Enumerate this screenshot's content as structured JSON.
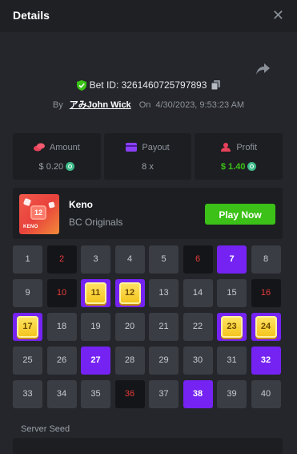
{
  "header": {
    "title": "Details",
    "close_icon": "close-icon"
  },
  "bet": {
    "id_label": "Bet ID: 3261460725797893",
    "by_label": "By",
    "username": "アみJohn Wick",
    "on_label": "On",
    "datetime": "4/30/2023, 9:53:23 AM"
  },
  "stats": {
    "amount": {
      "label": "Amount",
      "value": "$ 0.20",
      "icon": "coins-icon"
    },
    "payout": {
      "label": "Payout",
      "value": "8 x",
      "icon": "card-icon"
    },
    "profit": {
      "label": "Profit",
      "value": "$ 1.40",
      "icon": "user-icon"
    }
  },
  "game": {
    "name": "Keno",
    "category": "BC Originals",
    "play_label": "Play Now",
    "thumb_number": "12",
    "thumb_label": "KENO"
  },
  "board": {
    "cells": [
      {
        "n": "1",
        "s": "normal"
      },
      {
        "n": "2",
        "s": "miss"
      },
      {
        "n": "3",
        "s": "normal"
      },
      {
        "n": "4",
        "s": "normal"
      },
      {
        "n": "5",
        "s": "normal"
      },
      {
        "n": "6",
        "s": "miss"
      },
      {
        "n": "7",
        "s": "pick"
      },
      {
        "n": "8",
        "s": "normal"
      },
      {
        "n": "9",
        "s": "normal"
      },
      {
        "n": "10",
        "s": "miss"
      },
      {
        "n": "11",
        "s": "hit"
      },
      {
        "n": "12",
        "s": "hit"
      },
      {
        "n": "13",
        "s": "normal"
      },
      {
        "n": "14",
        "s": "normal"
      },
      {
        "n": "15",
        "s": "normal"
      },
      {
        "n": "16",
        "s": "miss"
      },
      {
        "n": "17",
        "s": "hit"
      },
      {
        "n": "18",
        "s": "normal"
      },
      {
        "n": "19",
        "s": "normal"
      },
      {
        "n": "20",
        "s": "normal"
      },
      {
        "n": "21",
        "s": "normal"
      },
      {
        "n": "22",
        "s": "normal"
      },
      {
        "n": "23",
        "s": "hit"
      },
      {
        "n": "24",
        "s": "hit"
      },
      {
        "n": "25",
        "s": "normal"
      },
      {
        "n": "26",
        "s": "normal"
      },
      {
        "n": "27",
        "s": "pick"
      },
      {
        "n": "28",
        "s": "normal"
      },
      {
        "n": "29",
        "s": "normal"
      },
      {
        "n": "30",
        "s": "normal"
      },
      {
        "n": "31",
        "s": "normal"
      },
      {
        "n": "32",
        "s": "pick"
      },
      {
        "n": "33",
        "s": "normal"
      },
      {
        "n": "34",
        "s": "normal"
      },
      {
        "n": "35",
        "s": "normal"
      },
      {
        "n": "36",
        "s": "miss"
      },
      {
        "n": "37",
        "s": "normal"
      },
      {
        "n": "38",
        "s": "pick"
      },
      {
        "n": "39",
        "s": "normal"
      },
      {
        "n": "40",
        "s": "normal"
      }
    ]
  },
  "seed": {
    "server_label": "Server Seed"
  },
  "colors": {
    "accent_purple": "#7523f3",
    "accent_green": "#3bc117",
    "miss_red": "#e53b3b",
    "background": "#24262b"
  }
}
